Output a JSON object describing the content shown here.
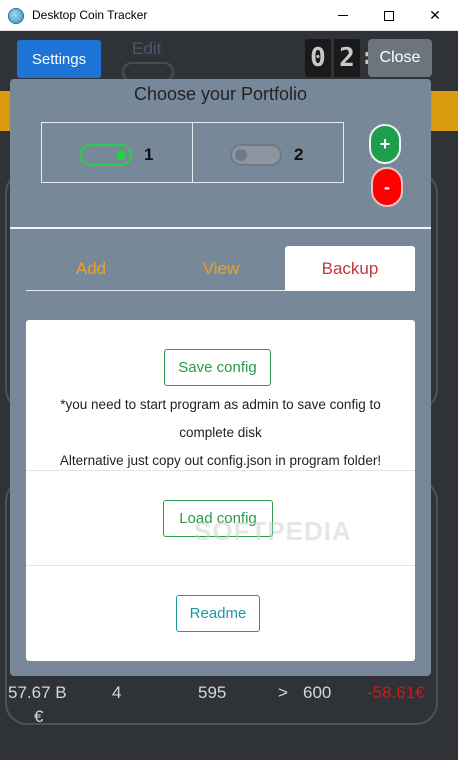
{
  "window": {
    "title": "Desktop Coin Tracker",
    "minimize_glyph": "",
    "maximize_glyph": "",
    "close_glyph": "✕"
  },
  "background": {
    "settings_label": "Settings",
    "edit_label": "Edit",
    "clock_digits": [
      "0",
      "2"
    ],
    "clock_separator": ":",
    "close_label": "Close",
    "row": {
      "amount": "57.67 B",
      "currency": "€",
      "col1": "4",
      "col2": "595",
      "col3": ">",
      "col4": "600",
      "change": "-58.61€"
    },
    "colors": {
      "orange_bar": "#d99a0e",
      "settings_button": "#1d74d6"
    }
  },
  "modal": {
    "title": "Choose your Portfolio",
    "portfolios": [
      {
        "label": "1",
        "enabled": true
      },
      {
        "label": "2",
        "enabled": false
      }
    ],
    "add_button": "+",
    "remove_button": "-",
    "tabs": [
      {
        "label": "Add",
        "active": false
      },
      {
        "label": "View",
        "active": false
      },
      {
        "label": "Backup",
        "active": true
      }
    ],
    "backup": {
      "save_label": "Save config",
      "note_line1": "*you need to start program as admin to save config to",
      "note_line2": "complete disk",
      "note_line3": "Alternative just copy out config.json in program folder!",
      "load_label": "Load config",
      "readme_label": "Readme"
    },
    "watermark": "SOFTPEDIA",
    "colors": {
      "panel_bg": "#778899",
      "active_tab_text": "#c0393b",
      "inactive_tab_text": "#f0a020"
    }
  }
}
